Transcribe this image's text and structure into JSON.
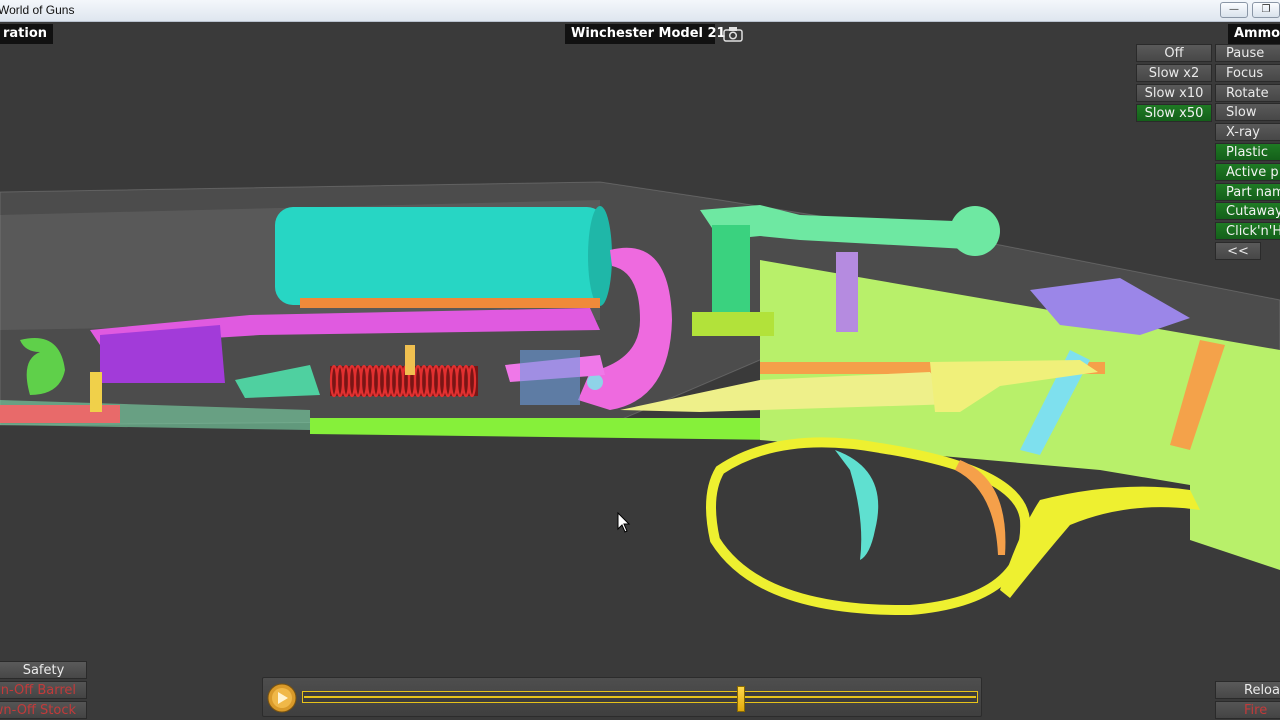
{
  "window": {
    "title": "World of Guns",
    "minimize_icon": "minimize-icon",
    "restore_icon": "restore-icon"
  },
  "header": {
    "left_label": "ration",
    "model_name": "Winchester Model 21",
    "camera_icon": "camera-icon",
    "ammo_label": "Ammo:"
  },
  "speed_menu": {
    "items": [
      {
        "label": "Off",
        "active": false
      },
      {
        "label": "Slow x2",
        "active": false
      },
      {
        "label": "Slow x10",
        "active": false
      },
      {
        "label": "Slow x50",
        "active": true
      }
    ]
  },
  "options_menu": {
    "items": [
      {
        "label": "Pause",
        "active": false
      },
      {
        "label": "Focus",
        "active": false
      },
      {
        "label": "Rotate",
        "active": false
      },
      {
        "label": "Slow",
        "active": false
      },
      {
        "label": "X-ray",
        "active": false
      },
      {
        "label": "Plastic",
        "active": true
      },
      {
        "label": "Active p",
        "active": true
      },
      {
        "label": "Part nam",
        "active": true
      },
      {
        "label": "Cutaway",
        "active": true
      },
      {
        "label": "Click'n'H",
        "active": true
      },
      {
        "label": "<<",
        "active": false
      }
    ]
  },
  "bottom_left": {
    "items": [
      {
        "label": "Safety",
        "disabled": false
      },
      {
        "label": "wn-Off Barrel",
        "disabled": true
      },
      {
        "label": "wn-Off Stock",
        "disabled": true
      }
    ]
  },
  "bottom_right": {
    "items": [
      {
        "label": "Reload",
        "disabled": false
      },
      {
        "label": "Fire",
        "disabled": true
      }
    ]
  },
  "timeline": {
    "progress": 0.65,
    "play_icon": "play-icon"
  },
  "colors": {
    "accent_green": "#1f7a24",
    "timeline_yellow": "#e6c21a",
    "spring_red": "#e23030"
  }
}
